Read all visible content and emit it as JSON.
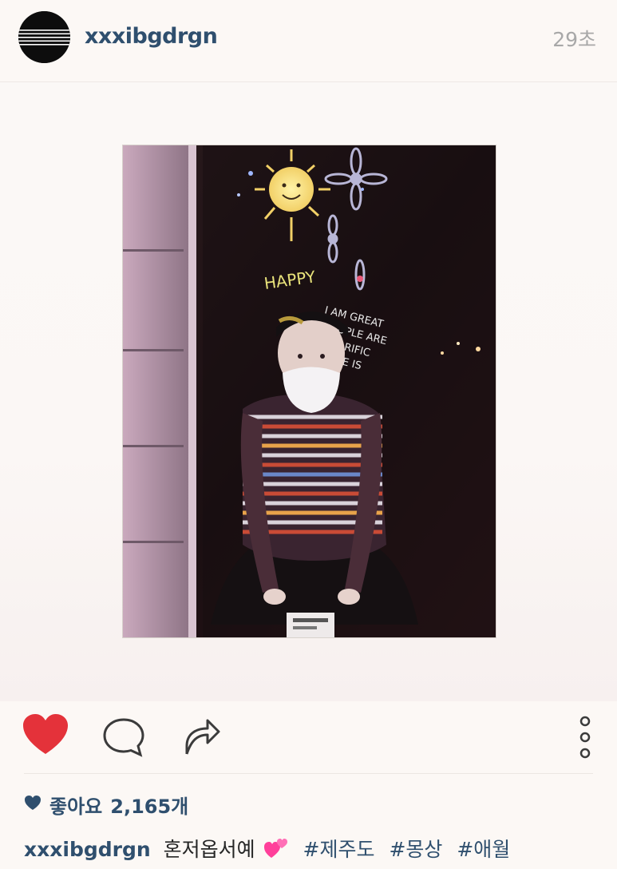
{
  "header": {
    "username": "xxxibgdrgn",
    "timestamp": "29초"
  },
  "post": {
    "photo": {
      "description_icon": "photo-image"
    },
    "likes": {
      "label": "좋아요",
      "count": "2,165개"
    },
    "caption": {
      "username": "xxxibgdrgn",
      "text": "혼저옵서예",
      "emoji": "two-hearts-emoji",
      "hashtags": [
        "#제주도",
        "#몽상",
        "#애월"
      ]
    }
  },
  "actions": {
    "like_icon": "heart-icon",
    "comment_icon": "comment-icon",
    "share_icon": "share-icon",
    "more_icon": "more-options-icon"
  },
  "colors": {
    "brand": "#2f4f6e",
    "heart": "#e4323a",
    "timestamp": "#a8a8a8",
    "background": "#fcf8f5"
  }
}
